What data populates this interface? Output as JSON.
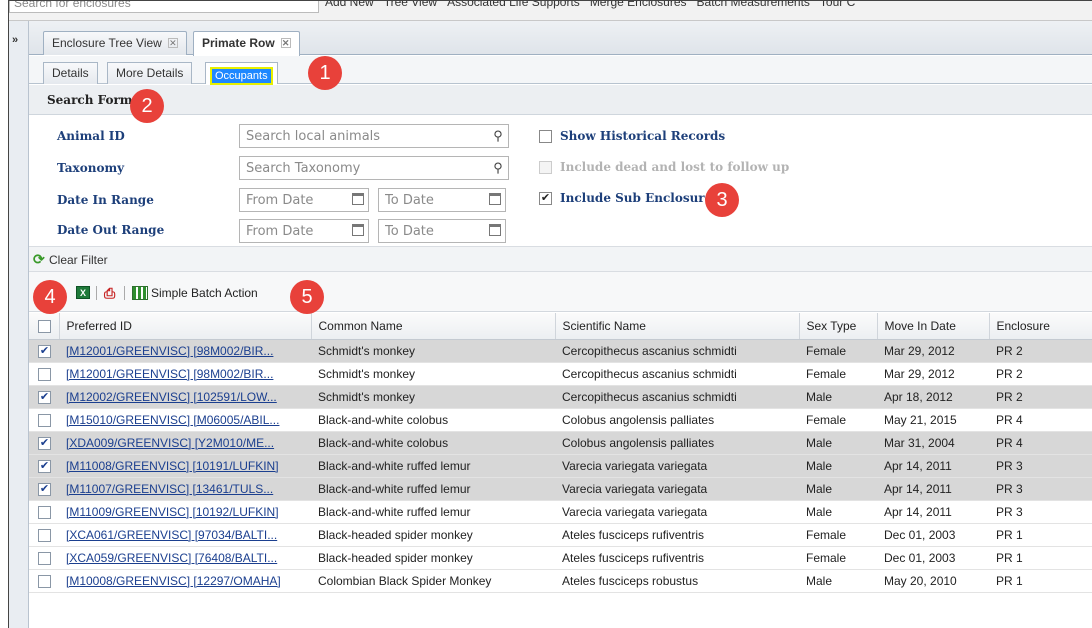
{
  "topbar": {
    "search_placeholder": "Search for enclosures",
    "items": [
      "Add New",
      "Tree View",
      "Associated Life Supports",
      "Merge Enclosures",
      "Batch Measurements",
      "Tour C"
    ]
  },
  "tabs": [
    {
      "label": "Enclosure Tree View",
      "active": false
    },
    {
      "label": "Primate Row",
      "active": true
    }
  ],
  "subtabs": [
    {
      "label": "Details",
      "active": false
    },
    {
      "label": "More Details",
      "active": false
    },
    {
      "label": "Occupants",
      "active": true
    }
  ],
  "badges": [
    "1",
    "2",
    "3",
    "4",
    "5"
  ],
  "search_form": {
    "title": "Search Form",
    "animal_id": {
      "label": "Animal ID",
      "placeholder": "Search local animals"
    },
    "taxonomy": {
      "label": "Taxonomy",
      "placeholder": "Search Taxonomy"
    },
    "date_in": {
      "label": "Date In Range",
      "from_placeholder": "From Date",
      "to_placeholder": "To Date"
    },
    "date_out": {
      "label": "Date Out Range",
      "from_placeholder": "From Date",
      "to_placeholder": "To Date"
    },
    "show_historical": {
      "label": "Show Historical Records",
      "checked": false
    },
    "include_dead": {
      "label": "Include dead and lost to follow up",
      "checked": false,
      "disabled": true
    },
    "include_sub": {
      "label": "Include Sub Enclosure",
      "checked": true
    }
  },
  "toolbar": {
    "clear_filter": "Clear Filter",
    "simple_batch_action": "Simple Batch Action"
  },
  "grid": {
    "columns": [
      "Preferred ID",
      "Common Name",
      "Scientific Name",
      "Sex Type",
      "Move In Date",
      "Enclosure"
    ],
    "rows": [
      {
        "checked": true,
        "id": "[M12001/GREENVISC] [98M002/BIR...",
        "common": "Schmidt's monkey",
        "scientific": "Cercopithecus ascanius schmidti",
        "sex": "Female",
        "date": "Mar 29, 2012",
        "enclosure": "PR 2"
      },
      {
        "checked": false,
        "id": "[M12001/GREENVISC] [98M002/BIR...",
        "common": "Schmidt's monkey",
        "scientific": "Cercopithecus ascanius schmidti",
        "sex": "Female",
        "date": "Mar 29, 2012",
        "enclosure": "PR 2"
      },
      {
        "checked": true,
        "id": "[M12002/GREENVISC] [102591/LOW...",
        "common": "Schmidt's monkey",
        "scientific": "Cercopithecus ascanius schmidti",
        "sex": "Male",
        "date": "Apr 18, 2012",
        "enclosure": "PR 2"
      },
      {
        "checked": false,
        "id": "[M15010/GREENVISC] [M06005/ABIL...",
        "common": "Black-and-white colobus",
        "scientific": "Colobus angolensis palliates",
        "sex": "Female",
        "date": "May 21, 2015",
        "enclosure": "PR 4"
      },
      {
        "checked": true,
        "id": "[XDA009/GREENVISC] [Y2M010/ME...",
        "common": "Black-and-white colobus",
        "scientific": "Colobus angolensis palliates",
        "sex": "Male",
        "date": "Mar 31, 2004",
        "enclosure": "PR 4"
      },
      {
        "checked": true,
        "id": "[M11008/GREENVISC] [10191/LUFKIN]",
        "common": "Black-and-white ruffed lemur",
        "scientific": "Varecia variegata variegata",
        "sex": "Male",
        "date": "Apr 14, 2011",
        "enclosure": "PR 3"
      },
      {
        "checked": true,
        "id": "[M11007/GREENVISC] [13461/TULS...",
        "common": "Black-and-white ruffed lemur",
        "scientific": "Varecia variegata variegata",
        "sex": "Male",
        "date": "Apr 14, 2011",
        "enclosure": "PR 3"
      },
      {
        "checked": false,
        "id": "[M11009/GREENVISC] [10192/LUFKIN]",
        "common": "Black-and-white ruffed lemur",
        "scientific": "Varecia variegata variegata",
        "sex": "Male",
        "date": "Apr 14, 2011",
        "enclosure": "PR 3"
      },
      {
        "checked": false,
        "id": "[XCA061/GREENVISC] [97034/BALTI...",
        "common": "Black-headed spider monkey",
        "scientific": "Ateles fusciceps rufiventris",
        "sex": "Female",
        "date": "Dec 01, 2003",
        "enclosure": "PR 1"
      },
      {
        "checked": false,
        "id": "[XCA059/GREENVISC] [76408/BALTI...",
        "common": "Black-headed spider monkey",
        "scientific": "Ateles fusciceps rufiventris",
        "sex": "Female",
        "date": "Dec 01, 2003",
        "enclosure": "PR 1"
      },
      {
        "checked": false,
        "id": "[M10008/GREENVISC] [12297/OMAHA]",
        "common": "Colombian Black Spider Monkey",
        "scientific": "Ateles fusciceps robustus",
        "sex": "Male",
        "date": "May 20, 2010",
        "enclosure": "PR 1"
      }
    ]
  },
  "colors": {
    "badge": "#e8413a",
    "link": "#1b3f8f",
    "label": "#1d3f7a",
    "selected_row": "#d7d7d7",
    "occupants_highlight": "#1e88ff"
  }
}
